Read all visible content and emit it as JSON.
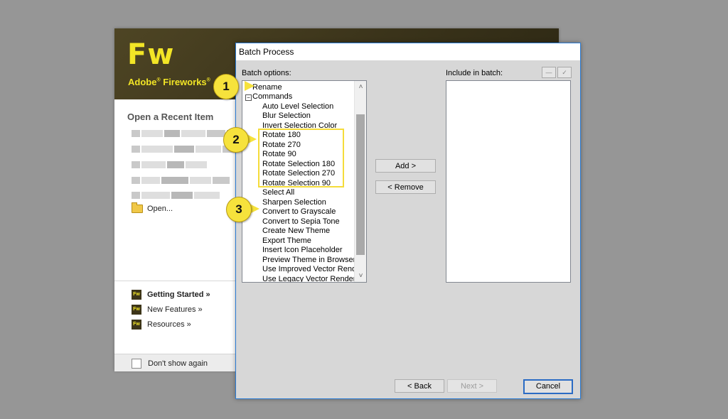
{
  "welcome": {
    "logo": "Fw",
    "product_name": "Adobe",
    "product_name_suffix": "Fireworks",
    "trademark": "®",
    "recent_title": "Open a Recent Item",
    "open_label": "Open...",
    "links": [
      {
        "label": "Getting Started »",
        "badge": "Fw"
      },
      {
        "label": "New Features »",
        "badge": "Fw"
      },
      {
        "label": "Resources »",
        "badge": "Fw"
      }
    ],
    "dont_show_label": "Don't show again"
  },
  "dialog": {
    "title": "Batch Process",
    "batch_options_label": "Batch options:",
    "include_label": "Include in batch:",
    "options": {
      "rename": "Rename",
      "commands": "Commands",
      "commands_toggle": "⊟",
      "items": [
        "Auto Level Selection",
        "Blur Selection",
        "Invert Selection Color",
        "Rotate 180",
        "Rotate 270",
        "Rotate 90",
        "Rotate Selection 180",
        "Rotate Selection 270",
        "Rotate Selection 90",
        "Select All",
        "Sharpen Selection",
        "Convert to Grayscale",
        "Convert to Sepia Tone",
        "Create New Theme",
        "Export Theme",
        "Insert Icon Placeholder",
        "Preview Theme in Browser",
        "Use Improved Vector Rende",
        "Use Legacy Vector Renderir"
      ]
    },
    "buttons": {
      "add": "Add >",
      "remove": "< Remove",
      "back": "< Back",
      "next": "Next >",
      "cancel": "Cancel",
      "remove_item_glyph": "—",
      "edit_item_glyph": "✓"
    },
    "scroll_up": "˄",
    "scroll_down": "˅"
  },
  "annotations": {
    "callouts": [
      "1",
      "2",
      "3"
    ],
    "color": "#f6e23c"
  }
}
